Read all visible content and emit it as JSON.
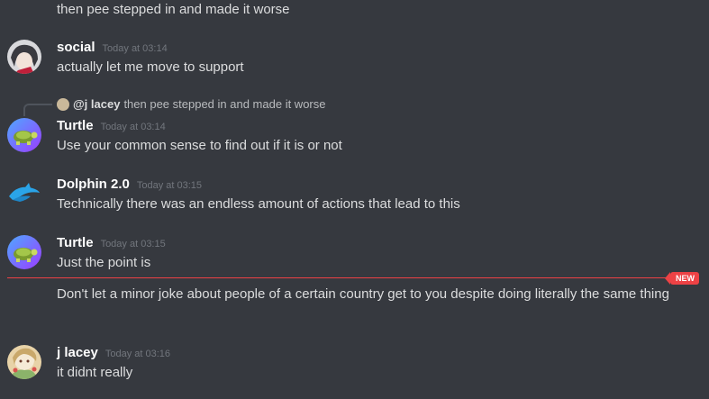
{
  "messages": {
    "top_continuation": "then pee stepped in and made it worse",
    "social": {
      "author": "social",
      "timestamp": "Today at 03:14",
      "text": "actually let me move to support"
    },
    "reply": {
      "mention": "@j lacey",
      "preview": "then pee stepped in and made it worse"
    },
    "turtle1": {
      "author": "Turtle",
      "timestamp": "Today at 03:14",
      "text": "Use your common sense to find out if it is or not"
    },
    "dolphin": {
      "author": "Dolphin 2.0",
      "timestamp": "Today at 03:15",
      "text": "Technically there was an endless amount of actions that lead to this"
    },
    "turtle2": {
      "author": "Turtle",
      "timestamp": "Today at 03:15",
      "text": "Just the point is",
      "followup": "Don't let a minor joke about people of a certain country get to you despite doing literally the same thing"
    },
    "jlacey": {
      "author": "j lacey",
      "timestamp": "Today at 03:16",
      "text": "it didnt really"
    }
  },
  "divider": {
    "label": "NEW"
  },
  "colors": {
    "background": "#36393f",
    "text": "#dcddde",
    "timestamp": "#72767d",
    "new": "#ed4245"
  }
}
